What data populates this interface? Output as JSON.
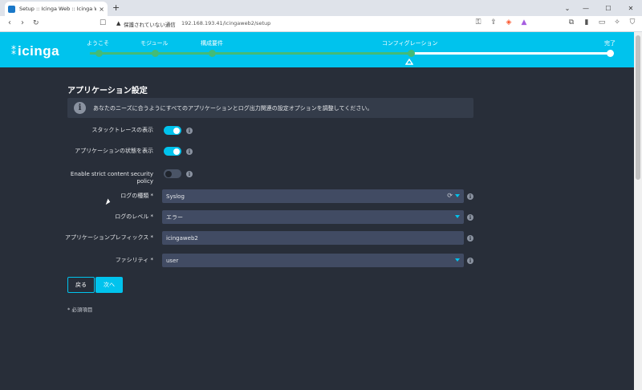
{
  "browser": {
    "tab_title": "Setup :: Icinga Web :: Icinga We",
    "tab_close": "×",
    "new_tab": "+",
    "insecure_label": "保護されていない通信",
    "url": "192.168.193.41/icingaweb2/setup"
  },
  "header": {
    "logo": "icinga",
    "steps": [
      "ようこそ",
      "モジュール",
      "構成要件",
      "コンフィグレーション",
      "完了"
    ],
    "progress_percent": 72
  },
  "form": {
    "section_title": "アプリケーション設定",
    "info_text": "あなたのニーズに合うようにすべてのアプリケーションとログ出力関連の設定オプションを調整してください。",
    "toggles": [
      {
        "label": "スタックトレースの表示",
        "on": true
      },
      {
        "label": "アプリケーションの状態を表示",
        "on": true
      },
      {
        "label": "Enable strict content security policy",
        "on": false
      }
    ],
    "fields": [
      {
        "label": "ログの種類 *",
        "value": "Syslog",
        "type": "select"
      },
      {
        "label": "ログのレベル *",
        "value": "エラー",
        "type": "select"
      },
      {
        "label": "アプリケーションプレフィックス *",
        "value": "icingaweb2",
        "type": "text"
      },
      {
        "label": "ファシリティ *",
        "value": "user",
        "type": "select"
      }
    ],
    "back_label": "戻る",
    "next_label": "次へ",
    "required_note": "* 必須項目"
  },
  "colors": {
    "accent": "#00c3ed",
    "done": "#44bb77",
    "background": "#282e39",
    "field": "#414b63"
  }
}
